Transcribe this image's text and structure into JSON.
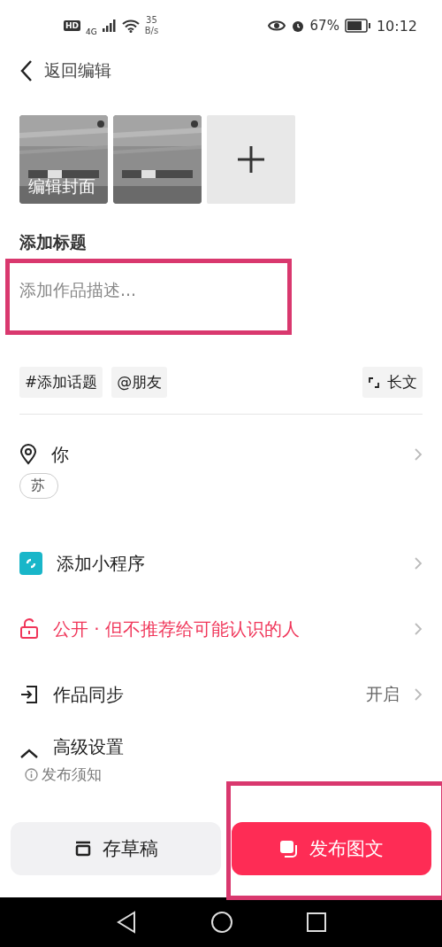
{
  "status_bar": {
    "hd": "HD",
    "net_speed": "35",
    "net_unit": "B/s",
    "network": "4G",
    "battery": "67%",
    "time": "10:12"
  },
  "header": {
    "back_label": "返回编辑"
  },
  "thumbnails": [
    {
      "kind": "picture",
      "caption": "编辑封面"
    },
    {
      "kind": "picture"
    },
    {
      "kind": "add"
    }
  ],
  "title_placeholder": "添加标题",
  "description_placeholder": "添加作品描述...",
  "chips": [
    {
      "label": "#添加话题"
    },
    {
      "label": "@朋友"
    }
  ],
  "long_text_label": "长文",
  "location": {
    "label": "你",
    "suggestions": [
      "苏"
    ]
  },
  "rows": [
    {
      "kind": "mini",
      "label": "添加小程序"
    },
    {
      "kind": "privacy",
      "label": "公开 · 但不推荐给可能认识的人"
    },
    {
      "kind": "sync",
      "label": "作品同步",
      "value": "开启"
    },
    {
      "kind": "advanced",
      "label": "高级设置"
    }
  ],
  "notice": "发布须知",
  "draft_button": "存草稿",
  "publish_button": "发布图文"
}
